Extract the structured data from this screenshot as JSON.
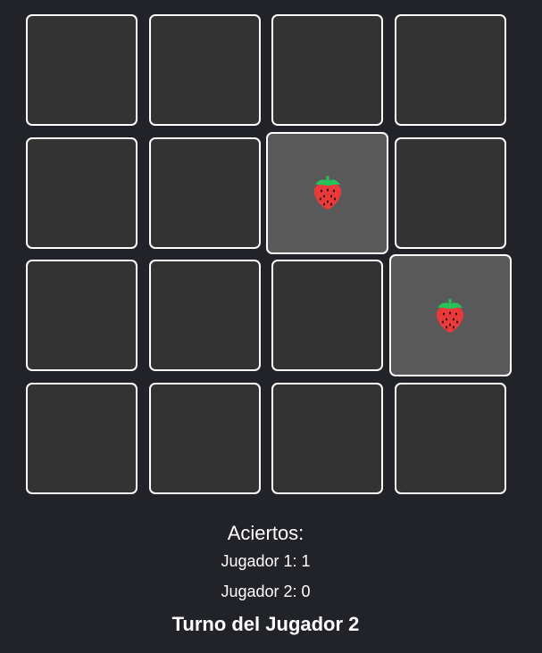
{
  "board": {
    "rows": 4,
    "cols": 4,
    "cards": [
      {
        "state": "hidden"
      },
      {
        "state": "hidden"
      },
      {
        "state": "hidden"
      },
      {
        "state": "hidden"
      },
      {
        "state": "hidden"
      },
      {
        "state": "hidden"
      },
      {
        "state": "revealed",
        "icon": "strawberry-icon"
      },
      {
        "state": "hidden"
      },
      {
        "state": "hidden"
      },
      {
        "state": "hidden"
      },
      {
        "state": "hidden"
      },
      {
        "state": "revealed",
        "icon": "strawberry-icon"
      },
      {
        "state": "hidden"
      },
      {
        "state": "hidden"
      },
      {
        "state": "hidden"
      },
      {
        "state": "hidden"
      }
    ]
  },
  "scores": {
    "title": "Aciertos:",
    "player1": "Jugador 1: 1",
    "player2": "Jugador 2: 0"
  },
  "turn": "Turno del Jugador 2",
  "colors": {
    "background": "#212328",
    "card_back": "#333333",
    "card_revealed": "#595959",
    "card_border": "#ffffff",
    "strawberry_red": "#e83a3a",
    "strawberry_leaf": "#27c25a"
  }
}
